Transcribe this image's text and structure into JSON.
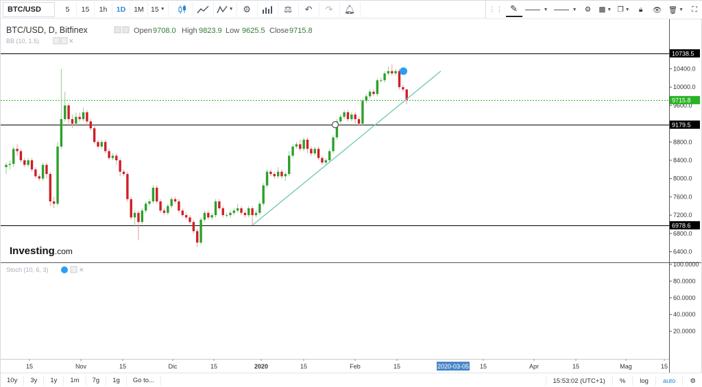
{
  "toolbar": {
    "symbol": "BTC/USD",
    "intervals": [
      {
        "label": "5",
        "active": false
      },
      {
        "label": "15",
        "active": false
      },
      {
        "label": "1h",
        "active": false
      },
      {
        "label": "1D",
        "active": true
      },
      {
        "label": "1M",
        "active": false
      },
      {
        "label": "15",
        "active": false
      }
    ]
  },
  "legend": {
    "title": "BTC/USD, D, Bitfinex",
    "open_label": "Open",
    "open": "9708.0",
    "high_label": "High",
    "high": "9823.9",
    "low_label": "Low",
    "low": "9625.5",
    "close_label": "Close",
    "close": "9715.8"
  },
  "indicators": {
    "main": "BB (10, 1.5)",
    "sub": "Stoch (10, 6, 3)"
  },
  "logo": {
    "main": "Investing",
    "suffix": ".com"
  },
  "colors": {
    "up": "#2ca02c",
    "down": "#cc2027",
    "trendline": "#76c9b8",
    "price_line": "#29b324",
    "sr_line": "#000000"
  },
  "chart_data": {
    "type": "candlestick",
    "title": "BTC/USD, D, Bitfinex",
    "ylim": [
      6300,
      10900
    ],
    "yticks": [
      6400,
      6800,
      7200,
      7600,
      8000,
      8400,
      8800,
      9600,
      10000,
      10400
    ],
    "xticks": [
      "15",
      "Nov",
      "15",
      "Dic",
      "15",
      "2020",
      "15",
      "Feb",
      "15",
      "2020-03-05",
      "15",
      "Apr",
      "15",
      "Mag",
      "15"
    ],
    "price_labels": {
      "top_resistance": "10738.5",
      "last_price": "9715.8",
      "mid_resistance": "9179.5",
      "support": "6978.6"
    },
    "stochastic": {
      "ylim": [
        0,
        100
      ],
      "yticks": [
        "100.0000",
        "80.0000",
        "60.0000",
        "40.0000",
        "20.0000"
      ]
    },
    "candles": [
      [
        8250,
        8300,
        8350,
        8100
      ],
      [
        8300,
        8320,
        8400,
        8200
      ],
      [
        8320,
        8650,
        8700,
        8250
      ],
      [
        8650,
        8600,
        8750,
        8500
      ],
      [
        8600,
        8400,
        8650,
        8350
      ],
      [
        8400,
        8300,
        8450,
        8250
      ],
      [
        8300,
        8400,
        8450,
        8250
      ],
      [
        8400,
        8200,
        8450,
        8150
      ],
      [
        8200,
        8050,
        8250,
        8000
      ],
      [
        8050,
        8000,
        8100,
        7950
      ],
      [
        8000,
        8300,
        8350,
        7950
      ],
      [
        8300,
        8100,
        8350,
        8000
      ],
      [
        8100,
        7500,
        8150,
        7400
      ],
      [
        7500,
        7450,
        7600,
        7350
      ],
      [
        7450,
        8700,
        8800,
        7400
      ],
      [
        8700,
        9300,
        10400,
        8650
      ],
      [
        9300,
        9600,
        9900,
        9250
      ],
      [
        9600,
        9300,
        9650,
        9200
      ],
      [
        9300,
        9200,
        9400,
        9100
      ],
      [
        9200,
        9350,
        9450,
        9150
      ],
      [
        9350,
        9300,
        9450,
        9250
      ],
      [
        9300,
        9450,
        9550,
        9250
      ],
      [
        9450,
        9250,
        9500,
        9150
      ],
      [
        9250,
        9100,
        9300,
        9050
      ],
      [
        9100,
        8800,
        9150,
        8750
      ],
      [
        8800,
        8700,
        8850,
        8650
      ],
      [
        8700,
        8800,
        8850,
        8650
      ],
      [
        8800,
        8600,
        8850,
        8550
      ],
      [
        8600,
        8450,
        8650,
        8400
      ],
      [
        8450,
        8500,
        8550,
        8400
      ],
      [
        8500,
        8400,
        8550,
        8300
      ],
      [
        8400,
        8150,
        8450,
        8050
      ],
      [
        8150,
        8100,
        8200,
        8050
      ],
      [
        8100,
        7550,
        8150,
        7500
      ],
      [
        7550,
        7150,
        7600,
        7100
      ],
      [
        7150,
        7250,
        7300,
        6950
      ],
      [
        7250,
        7050,
        7300,
        6650
      ],
      [
        7050,
        7300,
        7350,
        7000
      ],
      [
        7300,
        7450,
        7500,
        7250
      ],
      [
        7450,
        7500,
        7550,
        7400
      ],
      [
        7500,
        7800,
        7850,
        7450
      ],
      [
        7800,
        7500,
        7850,
        7450
      ],
      [
        7500,
        7300,
        7550,
        7250
      ],
      [
        7300,
        7250,
        7350,
        7200
      ],
      [
        7250,
        7400,
        7450,
        7200
      ],
      [
        7400,
        7550,
        7600,
        7350
      ],
      [
        7550,
        7500,
        7600,
        7450
      ],
      [
        7500,
        7300,
        7550,
        7250
      ],
      [
        7300,
        7200,
        7350,
        7150
      ],
      [
        7200,
        7150,
        7250,
        7100
      ],
      [
        7150,
        7050,
        7200,
        7000
      ],
      [
        7050,
        6850,
        7100,
        6800
      ],
      [
        6850,
        6600,
        6900,
        6500
      ],
      [
        6600,
        7100,
        7150,
        6550
      ],
      [
        7100,
        7250,
        7300,
        7050
      ],
      [
        7250,
        7150,
        7300,
        7100
      ],
      [
        7150,
        7200,
        7250,
        7100
      ],
      [
        7200,
        7500,
        7550,
        7150
      ],
      [
        7500,
        7350,
        7550,
        7300
      ],
      [
        7350,
        7200,
        7400,
        7150
      ],
      [
        7200,
        7200,
        7250,
        7150
      ],
      [
        7200,
        7250,
        7300,
        7150
      ],
      [
        7250,
        7300,
        7350,
        7200
      ],
      [
        7300,
        7350,
        7450,
        7250
      ],
      [
        7350,
        7250,
        7400,
        7200
      ],
      [
        7250,
        7200,
        7300,
        7150
      ],
      [
        7200,
        7350,
        7400,
        7150
      ],
      [
        7350,
        7200,
        7400,
        6978
      ],
      [
        7200,
        7250,
        7300,
        7150
      ],
      [
        7250,
        7450,
        7500,
        7200
      ],
      [
        7450,
        7850,
        7900,
        7400
      ],
      [
        7850,
        8150,
        8200,
        7800
      ],
      [
        8150,
        8100,
        8200,
        8050
      ],
      [
        8100,
        8050,
        8150,
        8000
      ],
      [
        8050,
        8150,
        8250,
        8000
      ],
      [
        8150,
        8050,
        8200,
        8000
      ],
      [
        8050,
        8100,
        8150,
        7950
      ],
      [
        8100,
        8500,
        8600,
        8050
      ],
      [
        8500,
        8700,
        8750,
        8450
      ],
      [
        8700,
        8750,
        8800,
        8650
      ],
      [
        8750,
        8650,
        8850,
        8600
      ],
      [
        8650,
        8850,
        8900,
        8600
      ],
      [
        8850,
        8650,
        8900,
        8550
      ],
      [
        8650,
        8550,
        8700,
        8500
      ],
      [
        8550,
        8650,
        8700,
        8500
      ],
      [
        8650,
        8450,
        8700,
        8400
      ],
      [
        8450,
        8350,
        8500,
        8300
      ],
      [
        8350,
        8400,
        8450,
        8300
      ],
      [
        8400,
        8600,
        8650,
        8350
      ],
      [
        8600,
        8900,
        8950,
        8550
      ],
      [
        8900,
        9250,
        9300,
        8850
      ],
      [
        9250,
        9350,
        9400,
        9200
      ],
      [
        9350,
        9450,
        9500,
        9300
      ],
      [
        9450,
        9300,
        9500,
        9250
      ],
      [
        9300,
        9400,
        9450,
        9250
      ],
      [
        9400,
        9300,
        9450,
        9200
      ],
      [
        9300,
        9200,
        9350,
        9150
      ],
      [
        9200,
        9700,
        9750,
        9150
      ],
      [
        9700,
        9800,
        9850,
        9650
      ],
      [
        9800,
        9900,
        9950,
        9750
      ],
      [
        9900,
        9850,
        9950,
        9800
      ],
      [
        9850,
        10150,
        10200,
        9800
      ],
      [
        10150,
        10150,
        10200,
        10100
      ],
      [
        10150,
        10300,
        10350,
        10100
      ],
      [
        10300,
        10350,
        10450,
        10250
      ],
      [
        10350,
        10300,
        10500,
        10250
      ],
      [
        10300,
        10350,
        10400,
        10250
      ],
      [
        10350,
        10000,
        10400,
        9950
      ],
      [
        10000,
        9950,
        10050,
        9900
      ],
      [
        9950,
        9715.8,
        9823.9,
        9625.5
      ]
    ]
  },
  "bottombar": {
    "ranges": [
      "10y",
      "3y",
      "1y",
      "1m",
      "7g",
      "1g",
      "Go to..."
    ],
    "time": "15:53:02 (UTC+1)",
    "percent": "%",
    "log": "log",
    "auto": "auto"
  }
}
